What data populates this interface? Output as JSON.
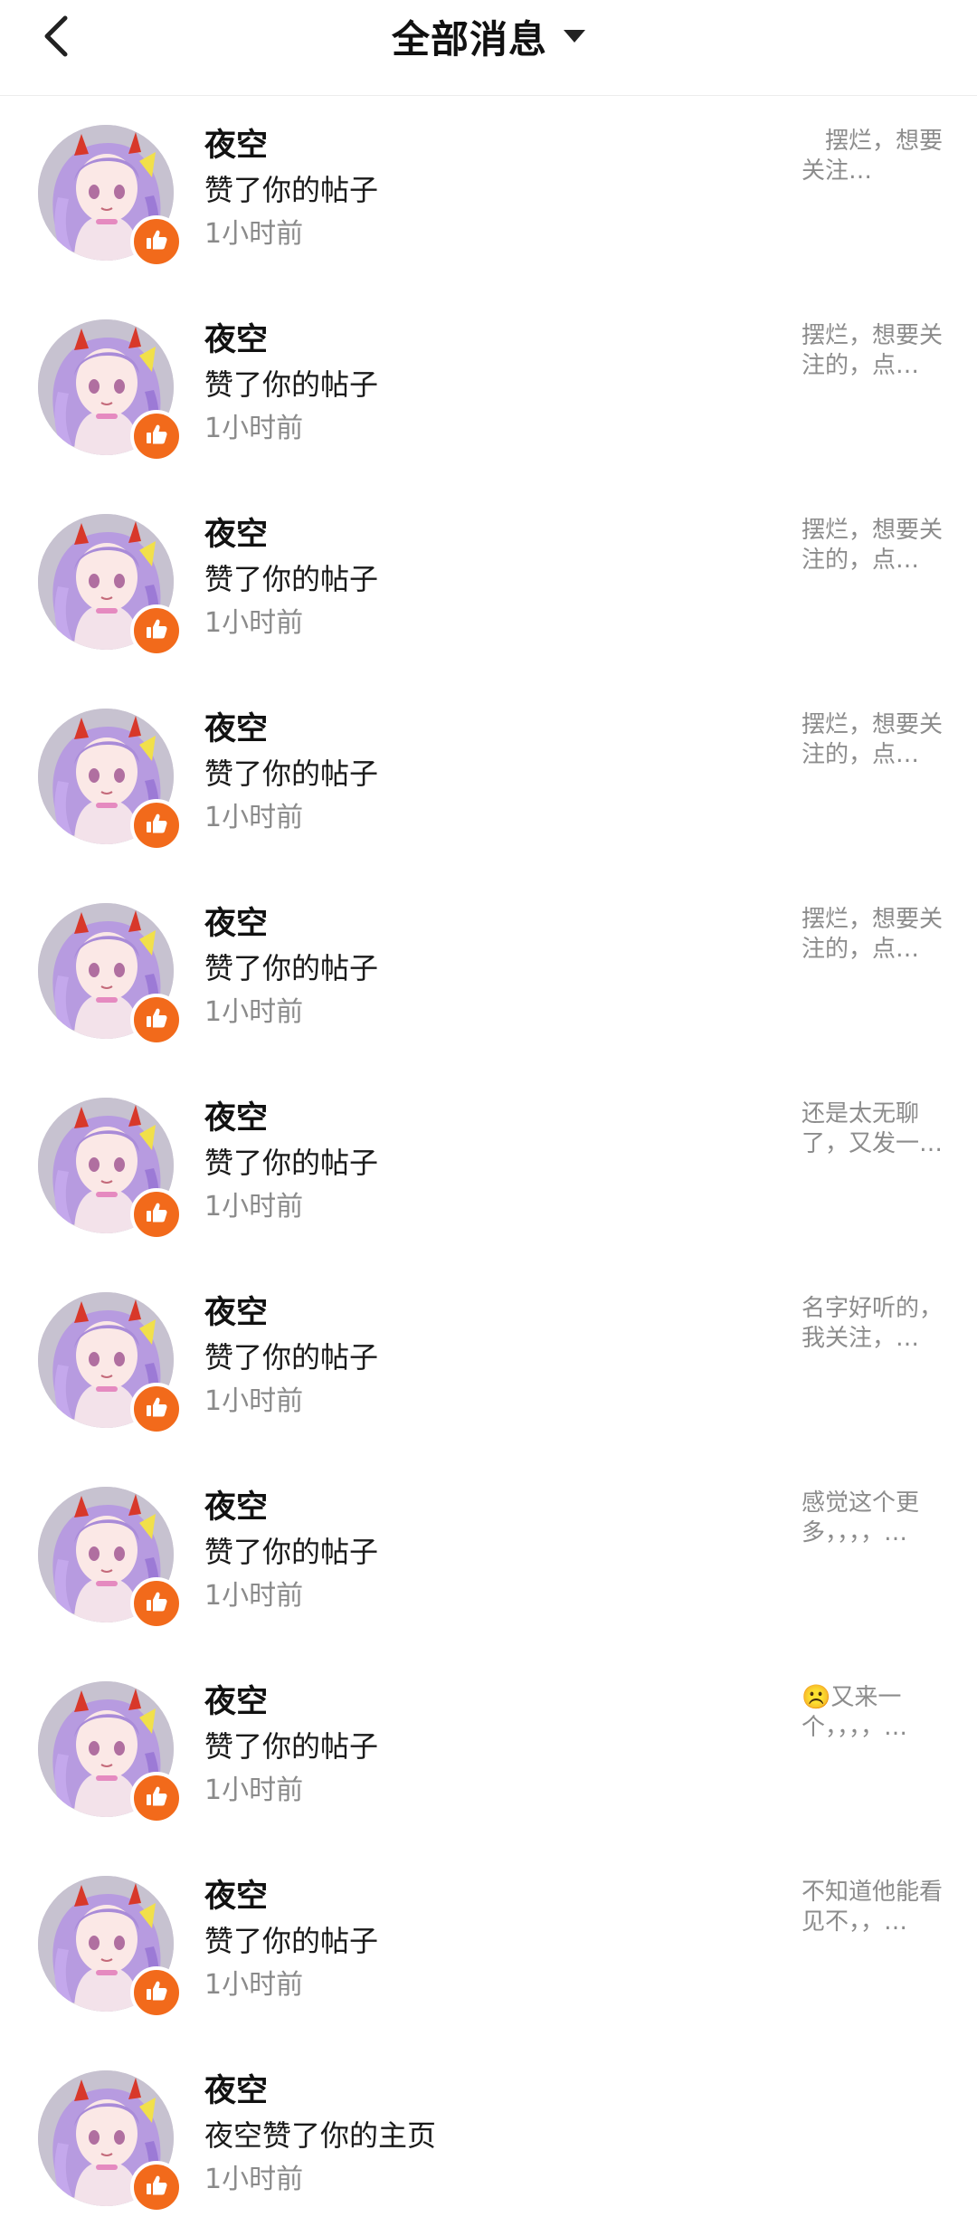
{
  "header": {
    "title": "全部消息"
  },
  "colors": {
    "like_badge": "#f26a1b",
    "time_text": "#8a8a8a",
    "preview_text": "#8c8c8c"
  },
  "notifications": [
    {
      "name": "夜空",
      "action": "赞了你的帖子",
      "time": "1小时前",
      "preview": "　摆烂，想要关注…"
    },
    {
      "name": "夜空",
      "action": "赞了你的帖子",
      "time": "1小时前",
      "preview": "摆烂，想要关注的，点…"
    },
    {
      "name": "夜空",
      "action": "赞了你的帖子",
      "time": "1小时前",
      "preview": "摆烂，想要关注的，点…"
    },
    {
      "name": "夜空",
      "action": "赞了你的帖子",
      "time": "1小时前",
      "preview": "摆烂，想要关注的，点…"
    },
    {
      "name": "夜空",
      "action": "赞了你的帖子",
      "time": "1小时前",
      "preview": "摆烂，想要关注的，点…"
    },
    {
      "name": "夜空",
      "action": "赞了你的帖子",
      "time": "1小时前",
      "preview": "还是太无聊了，又发一…"
    },
    {
      "name": "夜空",
      "action": "赞了你的帖子",
      "time": "1小时前",
      "preview": "名字好听的，我关注，…"
    },
    {
      "name": "夜空",
      "action": "赞了你的帖子",
      "time": "1小时前",
      "preview": "感觉这个更多，，，，…"
    },
    {
      "name": "夜空",
      "action": "赞了你的帖子",
      "time": "1小时前",
      "preview": "☹️又来一个，，，，…"
    },
    {
      "name": "夜空",
      "action": "赞了你的帖子",
      "time": "1小时前",
      "preview": "不知道他能看见不，，…"
    },
    {
      "name": "夜空",
      "action": "夜空赞了你的主页",
      "time": "1小时前",
      "preview": ""
    }
  ]
}
